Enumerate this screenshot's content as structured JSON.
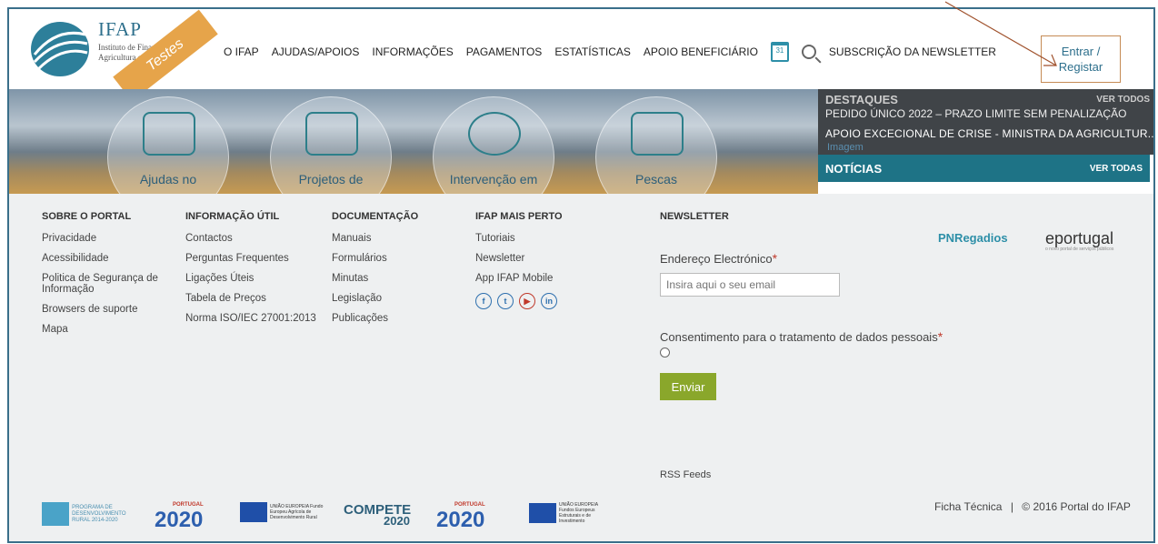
{
  "header": {
    "logo_title": "IFAP",
    "logo_sub": "Instituto de Financiamento da Agricultura e Pescas, I.P.",
    "ribbon": "Testes",
    "nav": [
      "O IFAP",
      "AJUDAS/APOIOS",
      "INFORMAÇÕES",
      "PAGAMENTOS",
      "ESTATÍSTICAS",
      "APOIO BENEFICIÁRIO"
    ],
    "calendar_day": "31",
    "newsletter_sub": "SUBSCRIÇÃO DA NEWSLETTER",
    "login_line1": "Entrar /",
    "login_line2": "Registar"
  },
  "hero": {
    "items": [
      "Ajudas no",
      "Projetos de",
      "Intervenção em",
      "Pescas"
    ]
  },
  "highlights": {
    "title": "DESTAQUES",
    "view_all": "VER TODOS",
    "item1": "PEDIDO ÚNICO 2022 – PRAZO LIMITE SEM PENALIZAÇÃO",
    "item2": "APOIO EXCECIONAL DE CRISE - MINISTRA DA AGRICULTUR...",
    "image_alt": "Imagem",
    "news_title": "NOTÍCIAS",
    "news_all": "VER TODAS"
  },
  "footer": {
    "cols": [
      {
        "title": "SOBRE O PORTAL",
        "items": [
          "Privacidade",
          "Acessibilidade",
          "Politica de Segurança de Informação",
          "Browsers de suporte",
          "Mapa"
        ]
      },
      {
        "title": "INFORMAÇÃO ÚTIL",
        "items": [
          "Contactos",
          "Perguntas Frequentes",
          "Ligações Úteis",
          "Tabela de Preços",
          "Norma ISO/IEC 27001:2013"
        ]
      },
      {
        "title": "DOCUMENTAÇÃO",
        "items": [
          "Manuais",
          "Formulários",
          "Minutas",
          "Legislação",
          "Publicações"
        ]
      },
      {
        "title": "IFAP MAIS PERTO",
        "items": [
          "Tutoriais",
          "Newsletter",
          "App IFAP Mobile"
        ]
      }
    ],
    "newsletter_title": "NEWSLETTER",
    "email_label": "Endereço Electrónico",
    "email_placeholder": "Insira aqui o seu email",
    "consent_label": "Consentimento para o tratamento de dados pessoais",
    "send_label": "Enviar",
    "rss": "RSS Feeds",
    "pn_logo": "PNRegadios",
    "eportugal": "eportugal",
    "eportugal_sub": "o novo portal de serviços públicos",
    "ficha": "Ficha Técnica",
    "sep": "|",
    "copyright": "© 2016 Portal do IFAP"
  },
  "logos": {
    "pdr": "PROGRAMA DE DESENVOLVIMENTO RURAL 2014-2020",
    "pt2020_a": "2020",
    "portugal_label": "PORTUGAL",
    "eu_a": "UNIÃO EUROPEIA Fundo Europeu Agrícola de Desenvolvimento Rural",
    "compete": "COMPETE",
    "compete_year": "2020",
    "pt2020_b": "2020",
    "eu_b": "UNIÃO EUROPEIA Fundos Europeus Estruturais e de Investimento"
  },
  "colors": {
    "teal": "#1e7386",
    "accent_green": "#8aa72b",
    "ribbon_orange": "#e6a44a"
  }
}
